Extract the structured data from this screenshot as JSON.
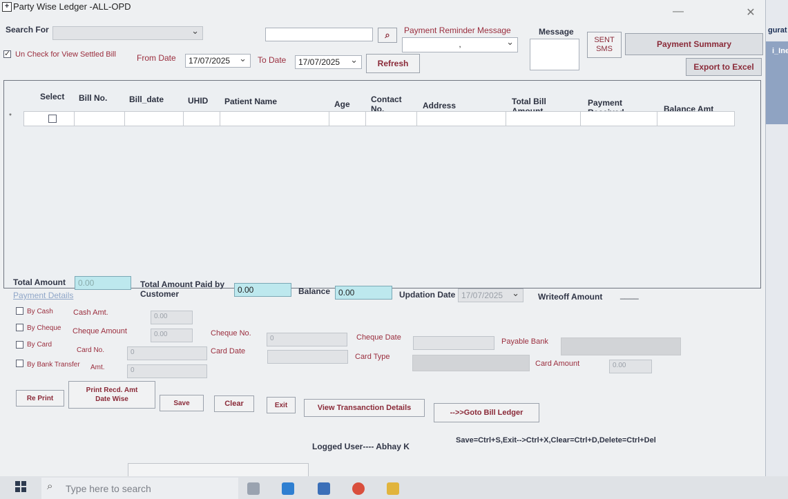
{
  "window": {
    "title": "Party Wise Ledger -ALL-OPD",
    "close_glyph": "✕",
    "minimize_glyph": "—"
  },
  "right_edge": {
    "text1": "gurat",
    "text2": "i_Ine"
  },
  "filters": {
    "search_for_label": "Search For",
    "uncheck_settled_label": "Un Check for View Settled Bill",
    "from_date_label": "From Date",
    "from_date_value": "17/07/2025",
    "to_date_label": "To Date",
    "to_date_value": "17/07/2025",
    "refresh_label": "Refresh",
    "reminder_label": "Payment Reminder Message",
    "reminder_value": ",",
    "message_label": "Message",
    "sent_sms_label": "SENT SMS",
    "payment_summary_label": "Payment Summary",
    "export_label": "Export to Excel"
  },
  "grid": {
    "headers": [
      "Select",
      "Bill No.",
      "Bill_date",
      "UHID",
      "Patient Name",
      "Age",
      "Contact No.",
      "Address",
      "Total Bill Amount",
      "Payment Received",
      "Balance Amt"
    ],
    "row_marker": "*"
  },
  "totals": {
    "total_amount_label": "Total Amount",
    "total_amount_value": "0.00",
    "payment_details_label": "Payment Details",
    "paid_by_customer_label": "Total Amount Paid by Customer",
    "paid_value": "0.00",
    "balance_label": "Balance",
    "balance_value": "0.00",
    "updation_date_label": "Updation Date",
    "updation_date_value": "17/07/2025",
    "writeoff_label": "Writeoff Amount",
    "writeoff_value": "____"
  },
  "payment": {
    "by_cash": "By Cash",
    "by_cheque": "By Cheque",
    "by_card": "By Card",
    "by_bank_transfer": "By Bank Transfer",
    "cash_amt_label": "Cash Amt.",
    "cash_amt_value": "0.00",
    "cheque_amount_label": "Cheque Amount",
    "cheque_amount_value": "0.00",
    "cheque_no_label": "Cheque No.",
    "cheque_no_value": "0",
    "cheque_date_label": "Cheque Date",
    "payable_bank_label": "Payable Bank",
    "card_no_label": "Card No.",
    "card_no_value": "0",
    "card_date_label": "Card Date",
    "card_type_label": "Card Type",
    "card_amount_label": "Card Amount",
    "card_amount_value": "0.00",
    "amt_label": "Amt.",
    "amt_value": "0"
  },
  "actions": {
    "reprint": "Re Print",
    "print_recd": "Print Recd. Amt Date Wise",
    "save": "Save",
    "clear": "Clear",
    "exit": "Exit",
    "view_transaction": "View Transanction Details",
    "goto_bill_ledger": "-->>Goto Bill Ledger"
  },
  "status": {
    "logged_user": "Logged User---- Abhay K",
    "shortcuts": "Save=Ctrl+S,Exit-->Ctrl+X,Clear=Ctrl+D,Delete=Ctrl+Del"
  },
  "taskbar": {
    "search_placeholder": "Type here to search"
  },
  "colors": {
    "accent_red": "#9a2d3d",
    "cyan_field": "#bde8ee",
    "window_bg": "#eef0f2"
  }
}
